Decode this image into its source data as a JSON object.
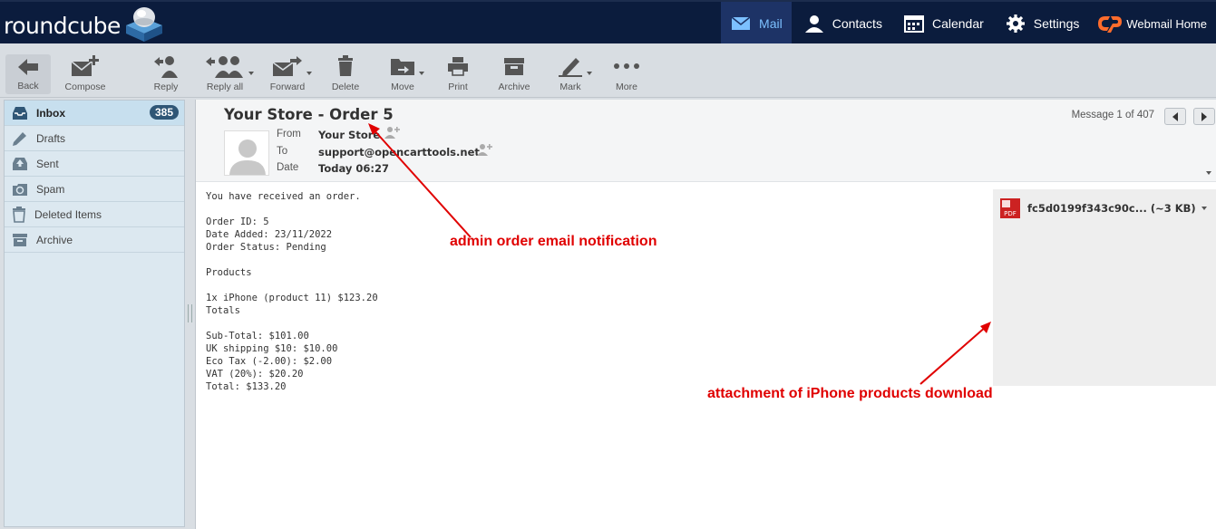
{
  "app": {
    "logo_text": "roundcube"
  },
  "topnav": [
    {
      "label": "Mail",
      "icon": "mail-icon",
      "active": true
    },
    {
      "label": "Contacts",
      "icon": "contacts-icon"
    },
    {
      "label": "Calendar",
      "icon": "calendar-icon"
    },
    {
      "label": "Settings",
      "icon": "gear-icon"
    },
    {
      "label": "Webmail Home",
      "icon": "cpanel-icon"
    }
  ],
  "toolbar": {
    "back": "Back",
    "compose": "Compose",
    "reply": "Reply",
    "reply_all": "Reply all",
    "forward": "Forward",
    "delete": "Delete",
    "move": "Move",
    "print": "Print",
    "archive": "Archive",
    "mark": "Mark",
    "more": "More"
  },
  "folders": [
    {
      "label": "Inbox",
      "icon": "inbox-icon",
      "count": "385",
      "active": true
    },
    {
      "label": "Drafts",
      "icon": "pencil-icon"
    },
    {
      "label": "Sent",
      "icon": "sent-icon"
    },
    {
      "label": "Spam",
      "icon": "spam-icon"
    },
    {
      "label": "Deleted Items",
      "icon": "trash-icon"
    },
    {
      "label": "Archive",
      "icon": "archive-icon"
    }
  ],
  "message": {
    "subject": "Your Store - Order 5",
    "from_label": "From",
    "from": "Your Store",
    "to_label": "To",
    "to": "support@opencarttools.net",
    "date_label": "Date",
    "date": "Today 06:27",
    "counter": "Message 1 of 407",
    "body": "You have received an order.\n\nOrder ID: 5\nDate Added: 23/11/2022\nOrder Status: Pending\n\nProducts\n\n1x iPhone (product 11) $123.20\nTotals\n\nSub-Total: $101.00\nUK shipping $10: $10.00\nEco Tax (-2.00): $2.00\nVAT (20%): $20.20\nTotal: $133.20"
  },
  "attachment": {
    "name": "fc5d0199f343c90c...",
    "size": "(~3 KB)",
    "icon": "pdf-icon",
    "icon_text": "PDF"
  },
  "annotations": {
    "email": "admin order email notification",
    "attachment": "attachment of iPhone products download"
  },
  "colors": {
    "topbar": "#0b1c3d",
    "active_nav": "#1d3366",
    "annotation": "#e00000",
    "badge": "#2f5676"
  }
}
